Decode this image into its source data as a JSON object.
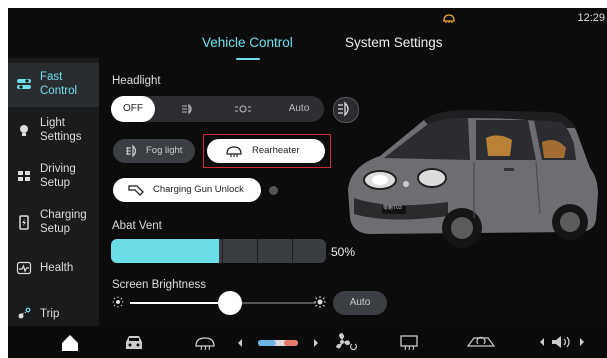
{
  "status": {
    "time": "12:29",
    "heater_icon": "rear-heater-icon"
  },
  "tabs": [
    {
      "label": "Vehicle Control",
      "active": true
    },
    {
      "label": "System Settings",
      "active": false
    }
  ],
  "sidebar": {
    "items": [
      {
        "label_line1": "Fast",
        "label_line2": "Control",
        "icon": "toggle-icon",
        "active": true
      },
      {
        "label_line1": "Light",
        "label_line2": "Settings",
        "icon": "bulb-icon",
        "active": false
      },
      {
        "label_line1": "Driving",
        "label_line2": "Setup",
        "icon": "grid-icon",
        "active": false
      },
      {
        "label_line1": "Charging",
        "label_line2": "Setup",
        "icon": "battery-icon",
        "active": false
      },
      {
        "label_line1": "Health",
        "label_line2": "",
        "icon": "health-icon",
        "active": false
      },
      {
        "label_line1": "Trip",
        "label_line2": "",
        "icon": "trip-icon",
        "active": false
      }
    ]
  },
  "headlight": {
    "title": "Headlight",
    "options": [
      {
        "label": "OFF",
        "icon": "",
        "selected": true
      },
      {
        "label": "",
        "icon": "low-beam-icon",
        "selected": false
      },
      {
        "label": "",
        "icon": "position-light-icon",
        "selected": false
      },
      {
        "label": "Auto",
        "icon": "",
        "selected": false
      }
    ],
    "high_beam_icon": "high-beam-icon"
  },
  "buttons": {
    "fog_light": "Fog light",
    "rearheater": "Rearheater",
    "charging_gun_unlock": "Charging Gun Unlock"
  },
  "abat_vent": {
    "title": "Abat Vent",
    "percent_text": "50%",
    "level": 0.5
  },
  "screen_brightness": {
    "title": "Screen Brightness",
    "level": 0.54,
    "auto_label": "Auto"
  },
  "car": {
    "plate": "零跑T03"
  },
  "bottom_bar": {
    "icons": [
      "home-icon",
      "car-icon",
      "front-defrost-icon",
      "temperature-slider",
      "fan-icon",
      "rear-defrost-icon",
      "recirculation-icon",
      "volume-icon"
    ]
  },
  "colors": {
    "accent": "#6fe0ee",
    "highlight": "#d22a3a",
    "panel": "#1a1b1d"
  }
}
